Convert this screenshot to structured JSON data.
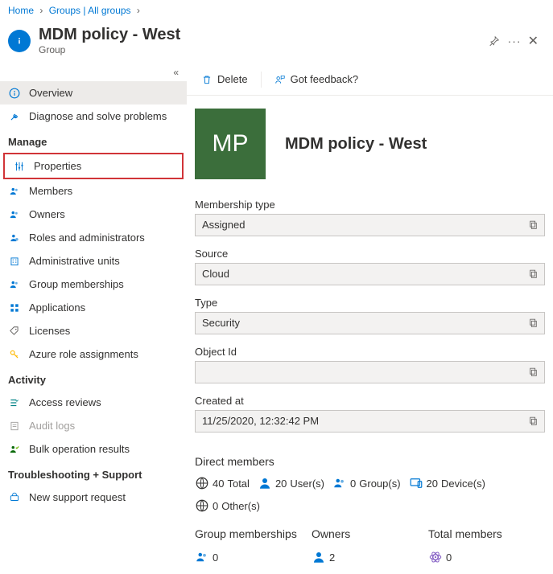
{
  "breadcrumb": {
    "home": "Home",
    "groups": "Groups | All groups"
  },
  "header": {
    "title": "MDM policy - West",
    "subtitle": "Group"
  },
  "sidebar": {
    "items": [
      {
        "label": "Overview"
      },
      {
        "label": "Diagnose and solve problems"
      }
    ],
    "manage_label": "Manage",
    "manage": [
      {
        "label": "Properties"
      },
      {
        "label": "Members"
      },
      {
        "label": "Owners"
      },
      {
        "label": "Roles and administrators"
      },
      {
        "label": "Administrative units"
      },
      {
        "label": "Group memberships"
      },
      {
        "label": "Applications"
      },
      {
        "label": "Licenses"
      },
      {
        "label": "Azure role assignments"
      }
    ],
    "activity_label": "Activity",
    "activity": [
      {
        "label": "Access reviews"
      },
      {
        "label": "Audit logs"
      },
      {
        "label": "Bulk operation results"
      }
    ],
    "troubleshoot_label": "Troubleshooting + Support",
    "troubleshoot": [
      {
        "label": "New support request"
      }
    ]
  },
  "toolbar": {
    "delete": "Delete",
    "feedback": "Got feedback?"
  },
  "group": {
    "initials": "MP",
    "name": "MDM policy - West"
  },
  "fields": {
    "membership_type": {
      "label": "Membership type",
      "value": "Assigned"
    },
    "source": {
      "label": "Source",
      "value": "Cloud"
    },
    "type": {
      "label": "Type",
      "value": "Security"
    },
    "object_id": {
      "label": "Object Id",
      "value": ""
    },
    "created_at": {
      "label": "Created at",
      "value": "11/25/2020, 12:32:42 PM"
    }
  },
  "direct_members": {
    "heading": "Direct members",
    "total_n": "40",
    "total_l": "Total",
    "users_n": "20",
    "users_l": "User(s)",
    "groups_n": "0",
    "groups_l": "Group(s)",
    "devices_n": "20",
    "devices_l": "Device(s)",
    "others_n": "0",
    "others_l": "Other(s)"
  },
  "summary": {
    "gm_label": "Group memberships",
    "gm_value": "0",
    "owners_label": "Owners",
    "owners_value": "2",
    "total_label": "Total members",
    "total_value": "0"
  }
}
